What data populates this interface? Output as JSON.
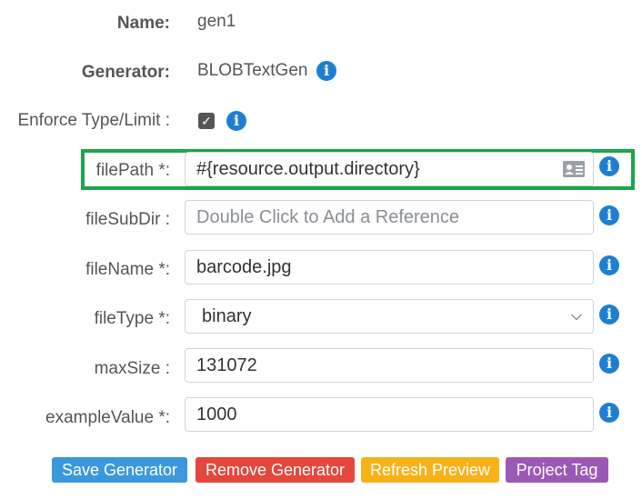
{
  "fields": {
    "name": {
      "label": "Name:",
      "value": "gen1"
    },
    "generator": {
      "label": "Generator:",
      "value": "BLOBTextGen"
    },
    "enforce": {
      "label": "Enforce Type/Limit :",
      "checked": true
    },
    "filePath": {
      "label": "filePath *:",
      "value": "#{resource.output.directory}"
    },
    "fileSubDir": {
      "label": "fileSubDir :",
      "value": "",
      "placeholder": "Double Click to Add a Reference"
    },
    "fileName": {
      "label": "fileName *:",
      "value": "barcode.jpg"
    },
    "fileType": {
      "label": "fileType *:",
      "value": "binary"
    },
    "maxSize": {
      "label": "maxSize :",
      "value": "131072"
    },
    "exampleValue": {
      "label": "exampleValue *:",
      "value": "1000"
    }
  },
  "buttons": {
    "save": "Save Generator",
    "remove": "Remove Generator",
    "refresh": "Refresh Preview",
    "tag": "Project Tag"
  },
  "icons": {
    "info": "info-icon",
    "card": "address-card-icon",
    "check": "checkmark"
  },
  "colors": {
    "info_blue": "#1e7fd1",
    "highlight_green": "#1aa64a",
    "save_blue": "#3b98dc",
    "remove_red": "#e4473c",
    "refresh_yellow": "#f7b21a",
    "tag_purple": "#9b59b6"
  }
}
